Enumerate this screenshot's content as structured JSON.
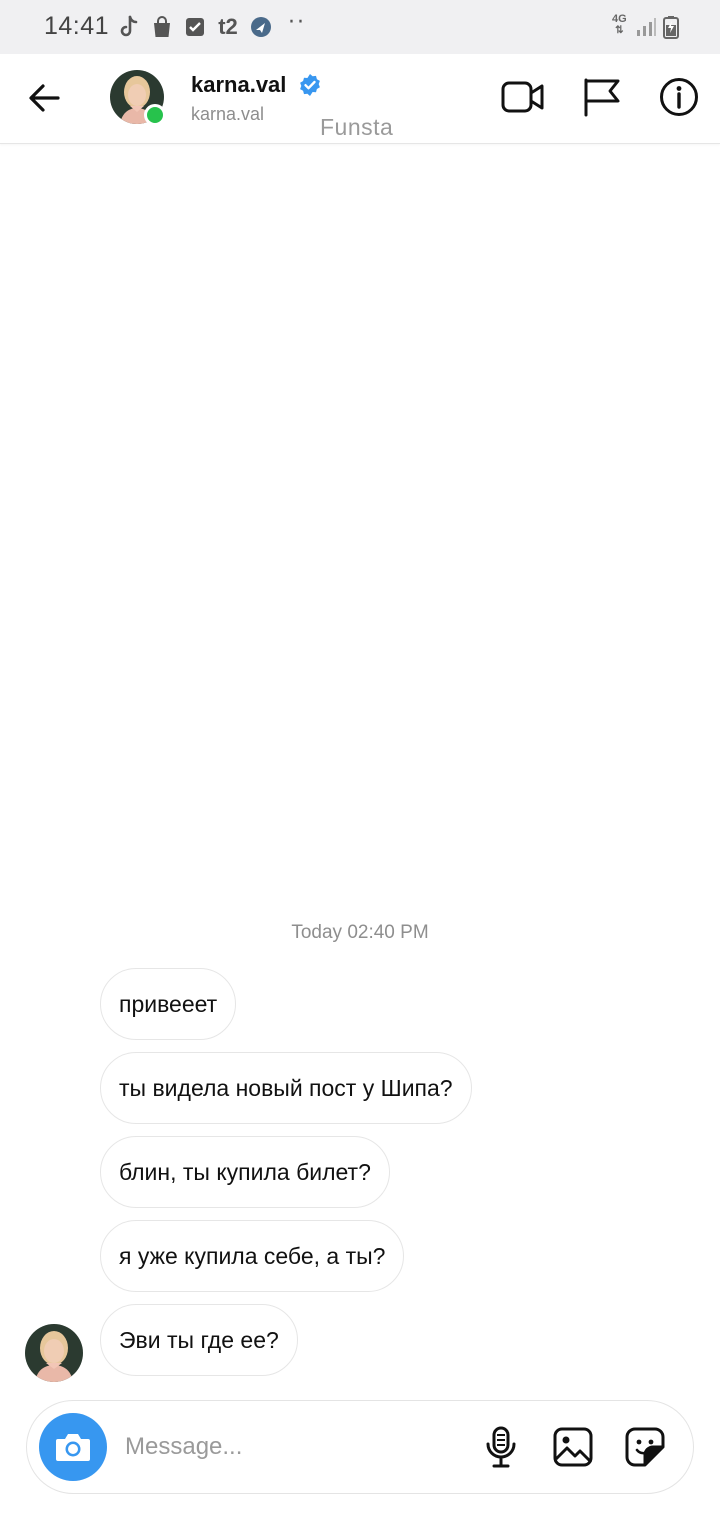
{
  "status_bar": {
    "time": "14:41",
    "icons": [
      "tiktok-icon",
      "shopping-bag-icon",
      "checkbox-icon",
      "t2-icon",
      "navigation-icon"
    ],
    "t2_text": "t2",
    "more": "··",
    "network": "4G",
    "signal": "signal-icon",
    "battery": "battery-icon"
  },
  "header": {
    "back_icon": "arrow-left-icon",
    "name": "karna.val",
    "username": "karna.val",
    "label": "Funsta",
    "verified_icon": "verified-badge-icon",
    "online_color": "#27c24c",
    "actions": [
      "video-call-icon",
      "flag-icon",
      "info-icon"
    ]
  },
  "chat": {
    "timestamp": "Today 02:40 PM",
    "messages": [
      {
        "text": "привееет"
      },
      {
        "text": "ты видела новый пост у Шипа?"
      },
      {
        "text": "блин, ты купила билет?"
      },
      {
        "text": "я уже купила себе, а ты?"
      },
      {
        "text": "Эви ты где ее?"
      }
    ]
  },
  "composer": {
    "placeholder": "Message...",
    "value": "",
    "accent": "#3797f0",
    "icons": [
      "camera-icon",
      "microphone-icon",
      "gallery-icon",
      "sticker-icon"
    ]
  }
}
